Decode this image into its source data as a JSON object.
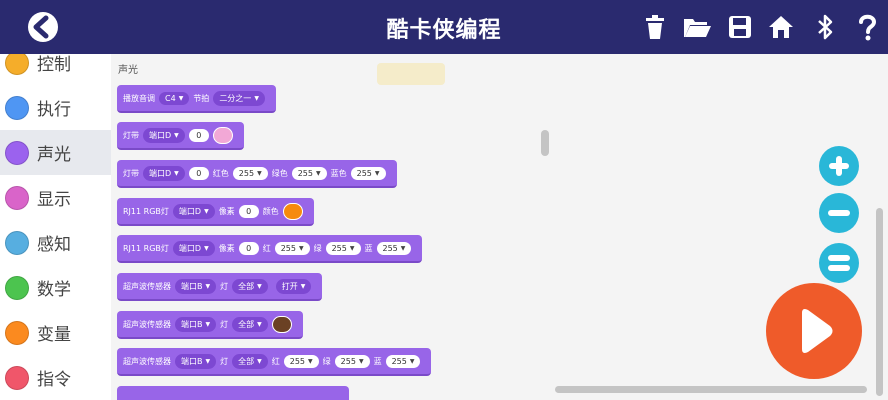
{
  "header": {
    "title": "酷卡侠编程",
    "icons": [
      "back-icon",
      "trash-icon",
      "folder-open-icon",
      "save-icon",
      "home-icon",
      "bluetooth-icon",
      "help-icon"
    ]
  },
  "colors": {
    "header_bg": "#2a2a6f",
    "block": "#9865e8",
    "accent_zoom": "#29b7d8",
    "run": "#ef5b2a"
  },
  "sidebar": {
    "items": [
      {
        "label": "控制",
        "color": "#f5ad2a"
      },
      {
        "label": "执行",
        "color": "#4f96f3"
      },
      {
        "label": "声光",
        "color": "#9b62ee",
        "selected": true
      },
      {
        "label": "显示",
        "color": "#d964c9"
      },
      {
        "label": "感知",
        "color": "#57aee0"
      },
      {
        "label": "数学",
        "color": "#4cc44f"
      },
      {
        "label": "变量",
        "color": "#fb8a1f"
      },
      {
        "label": "指令",
        "color": "#f0566a"
      }
    ]
  },
  "workspace": {
    "section_title": "声光",
    "blocks": {
      "b1": {
        "label": "播放音调",
        "note": "C4",
        "beat_label": "节拍",
        "beat": "二分之一"
      },
      "b2": {
        "label": "灯带",
        "port": "端口D",
        "value": "0",
        "color": "#f2a8d6"
      },
      "b3": {
        "label": "灯带",
        "port": "端口D",
        "value": "0",
        "red_label": "红色",
        "red": "255",
        "green_label": "绿色",
        "green": "255",
        "blue_label": "蓝色",
        "blue": "255"
      },
      "b4": {
        "label": "RJ11 RGB灯",
        "port": "端口D",
        "pixel_label": "像素",
        "pixel": "0",
        "color_label": "颜色",
        "color": "#f68a0e"
      },
      "b5": {
        "label": "RJ11 RGB灯",
        "port": "端口D",
        "pixel_label": "像素",
        "pixel": "0",
        "red_label": "红",
        "red": "255",
        "green_label": "绿",
        "green": "255",
        "blue_label": "蓝",
        "blue": "255"
      },
      "b6": {
        "label": "超声波传感器",
        "port": "端口B",
        "light_label": "灯",
        "which": "全部",
        "state": "打开"
      },
      "b7": {
        "label": "超声波传感器",
        "port": "端口B",
        "light_label": "灯",
        "which": "全部",
        "color": "#6b4124"
      },
      "b8": {
        "label": "超声波传感器",
        "port": "端口B",
        "light_label": "灯",
        "which": "全部",
        "red_label": "红",
        "red": "255",
        "green_label": "绿",
        "green": "255",
        "blue_label": "蓝",
        "blue": "255"
      }
    }
  }
}
